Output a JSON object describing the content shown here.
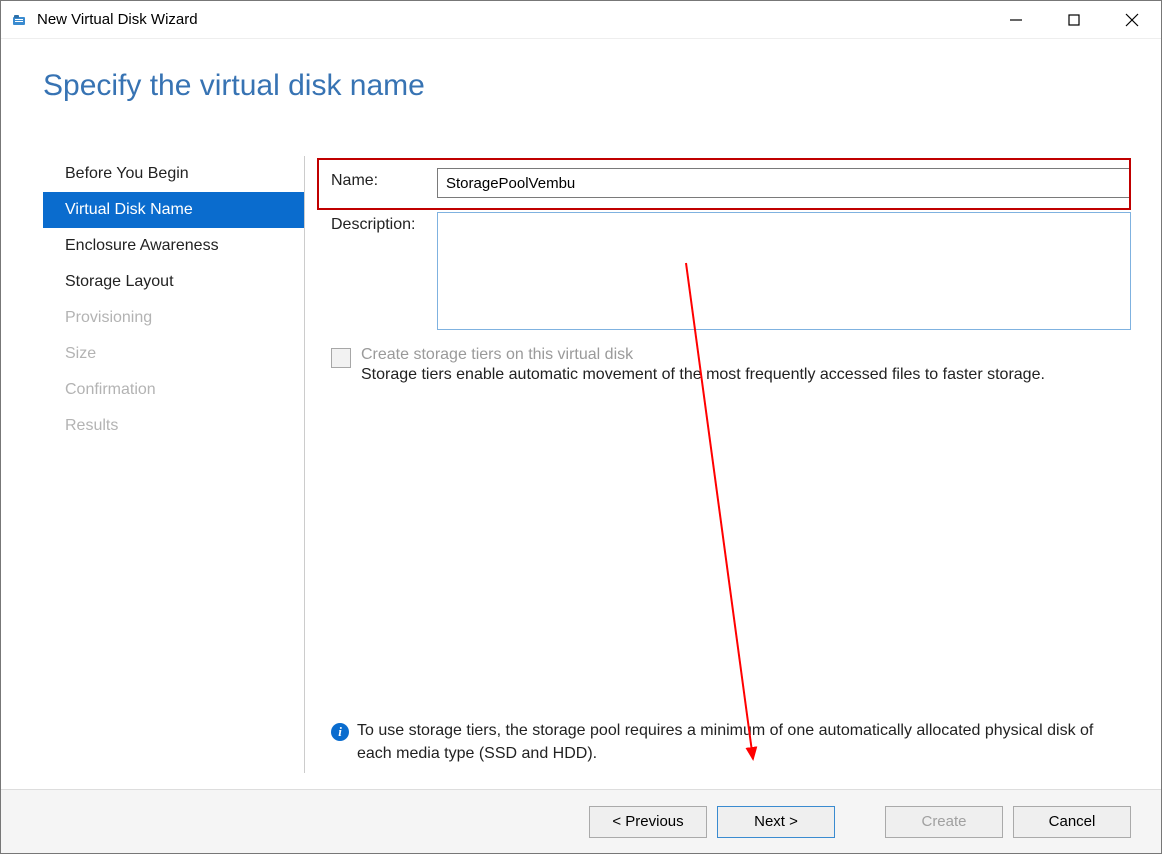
{
  "window": {
    "title": "New Virtual Disk Wizard"
  },
  "page": {
    "heading": "Specify the virtual disk name"
  },
  "sidebar": {
    "items": [
      {
        "label": "Before You Begin",
        "state": "normal"
      },
      {
        "label": "Virtual Disk Name",
        "state": "active"
      },
      {
        "label": "Enclosure Awareness",
        "state": "normal"
      },
      {
        "label": "Storage Layout",
        "state": "normal"
      },
      {
        "label": "Provisioning",
        "state": "disabled"
      },
      {
        "label": "Size",
        "state": "disabled"
      },
      {
        "label": "Confirmation",
        "state": "disabled"
      },
      {
        "label": "Results",
        "state": "disabled"
      }
    ]
  },
  "form": {
    "name_label": "Name:",
    "name_value": "StoragePoolVembu",
    "description_label": "Description:",
    "description_value": "",
    "checkbox_label": "Create storage tiers on this virtual disk",
    "checkbox_desc": "Storage tiers enable automatic movement of the most frequently accessed files to faster storage.",
    "checkbox_checked": false,
    "checkbox_enabled": false
  },
  "info": {
    "text": "To use storage tiers, the storage pool requires a minimum of one automatically allocated physical disk of each media type (SSD and HDD)."
  },
  "footer": {
    "previous": "< Previous",
    "next": "Next >",
    "create": "Create",
    "cancel": "Cancel"
  },
  "colors": {
    "accent": "#0a6cce",
    "heading": "#3773b3",
    "highlight": "#c00000"
  }
}
